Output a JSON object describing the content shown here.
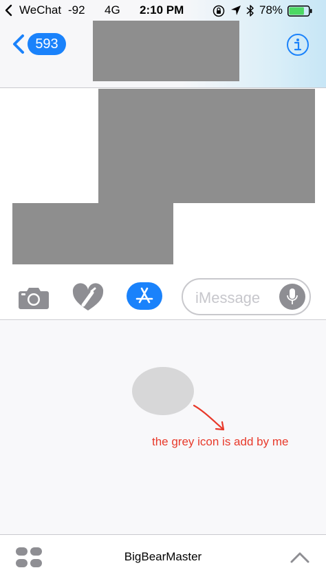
{
  "status_bar": {
    "carrier": "WeChat",
    "signal": "-92",
    "network": "4G",
    "time": "2:10 PM",
    "battery_percent": "78%",
    "battery_level": 0.78,
    "icons": [
      "back-arrow-icon",
      "orientation-lock-icon",
      "location-icon",
      "bluetooth-icon",
      "battery-icon"
    ]
  },
  "nav": {
    "back_count": "593",
    "info_icon": "info-icon"
  },
  "input_bar": {
    "placeholder": "iMessage",
    "icons": [
      "camera-icon",
      "digital-touch-icon",
      "app-store-icon",
      "microphone-icon"
    ]
  },
  "drawer": {
    "annotation": "the grey icon is add by me"
  },
  "bottom_bar": {
    "app_name": "BigBearMaster",
    "icons": [
      "app-drawer-icon",
      "chevron-up-icon"
    ]
  },
  "colors": {
    "accent": "#1a82fb",
    "annotation": "#e8392a",
    "redaction": "#8e8e8e",
    "battery": "#4cd964",
    "icon_grey": "#8e8e93"
  }
}
